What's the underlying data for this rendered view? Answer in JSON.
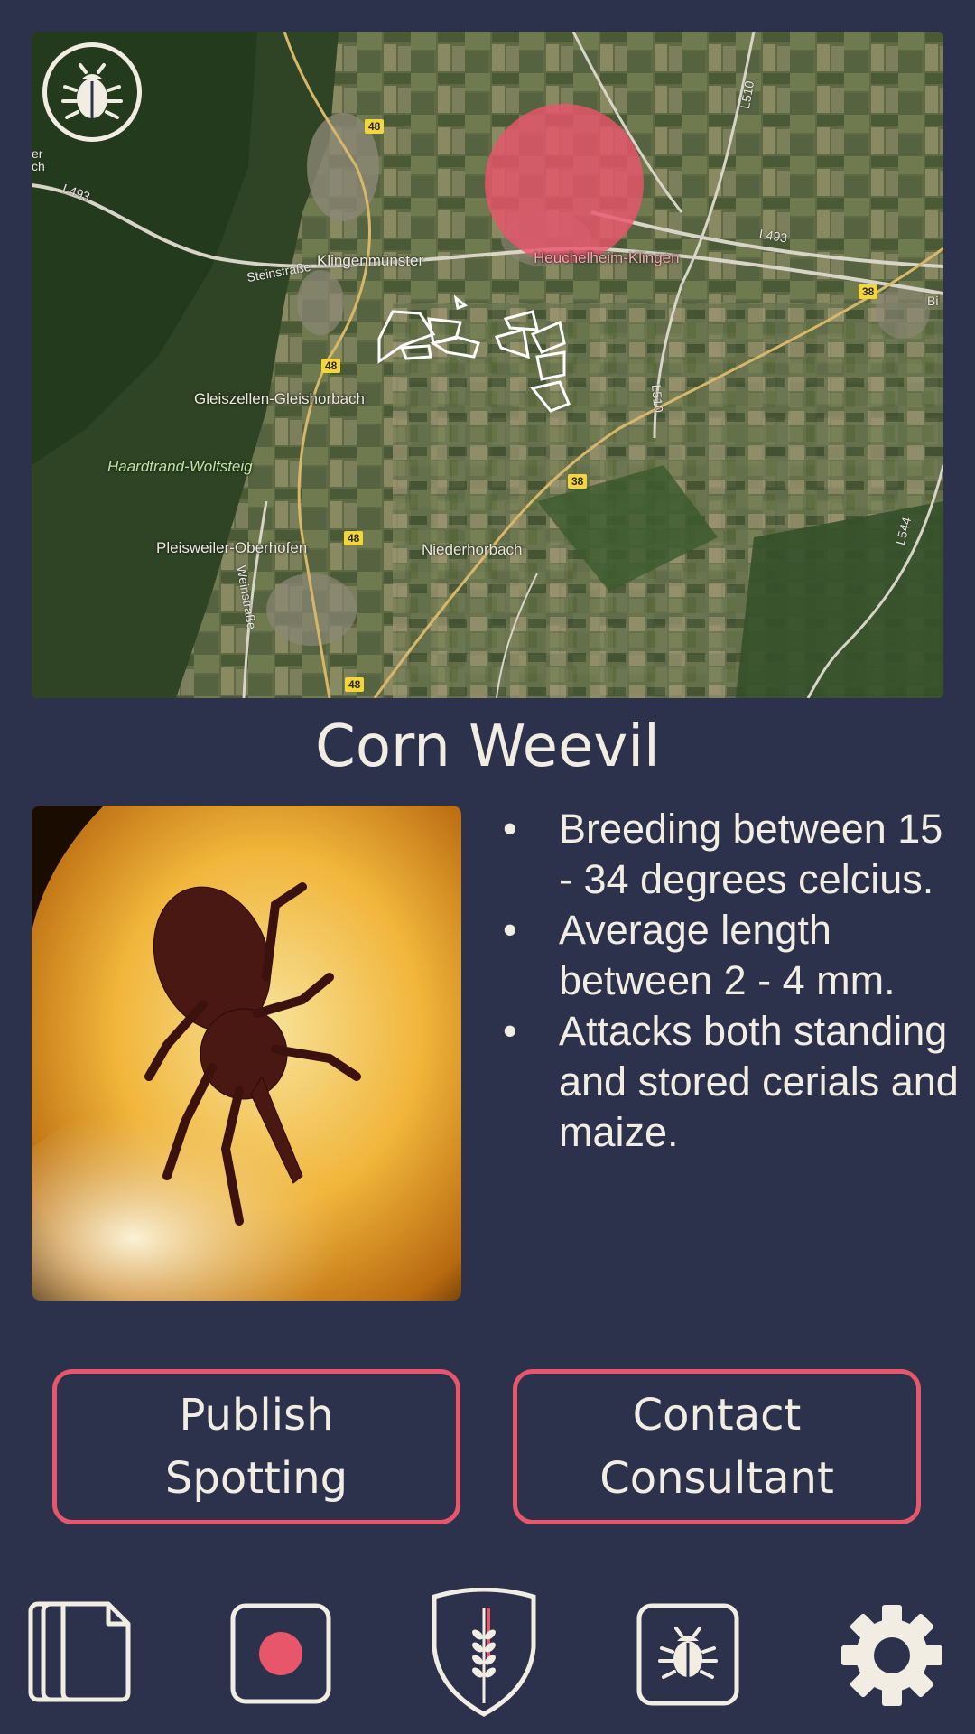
{
  "map": {
    "labels": {
      "klingenmunster": "Klingenmünster",
      "heuchelheim": "Heuchelheim-Klingen",
      "gleiszellen": "Gleiszellen-Gleishorbach",
      "haardtrand": "Haardtrand-Wolfsteig",
      "pleisweiler": "Pleisweiler-Oberhofen",
      "niederhorbach": "Niederhorbach",
      "steinstrasse": "Steinstraße",
      "weinstrasse": "Weinstraße",
      "l493_left": "L493",
      "l493_right": "L493",
      "l510_top": "L510",
      "l510_mid": "L510",
      "l544": "L544",
      "edge_left": "er ch",
      "edge_right": "Bi"
    },
    "road_badges": {
      "b48_top": "48",
      "b48_mid": "48",
      "b48_low": "48",
      "b48_bottom": "48",
      "b38_right": "38",
      "b38_mid": "38"
    },
    "spotting_zone_color": "#e8566c",
    "overlay_icon": "bug-icon"
  },
  "pest": {
    "name": "Corn Weevil",
    "photo_icon": "weevil-photo",
    "facts": [
      "Breeding between 15 - 34 degrees celcius.",
      "Average length between 2 - 4 mm.",
      "Attacks both standing and stored cerials and maize."
    ],
    "bullet": "•"
  },
  "actions": {
    "publish": "Publish\nSpotting",
    "contact": "Contact\nConsultant"
  },
  "nav": {
    "items": [
      "documents-icon",
      "record-icon",
      "wheat-shield-icon",
      "bug-icon",
      "gear-icon"
    ],
    "accent": "#e8566c"
  }
}
